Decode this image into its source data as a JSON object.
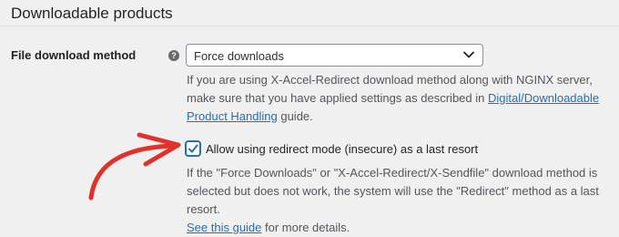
{
  "section": {
    "title": "Downloadable products"
  },
  "download_method": {
    "label": "File download method",
    "help_icon": "question-circle-icon",
    "selected_value": "Force downloads",
    "description": {
      "text_before": "If you are using X-Accel-Redirect download method along with NGINX server, make sure that you have applied settings as described in ",
      "link": "Digital/Downloadable Product Handling",
      "text_after": " guide."
    }
  },
  "redirect_fallback": {
    "checked": true,
    "label": "Allow using redirect mode (insecure) as a last resort",
    "description": {
      "text": "If the \"Force Downloads\" or \"X-Accel-Redirect/X-Sendfile\" download method is selected but does not work, the system will use the \"Redirect\" method as a last resort.",
      "link": "See this guide",
      "text_after": " for more details."
    }
  },
  "colors": {
    "background": "#f0f0f1",
    "accent": "#2271b1",
    "annotation_arrow": "#e0322b"
  }
}
